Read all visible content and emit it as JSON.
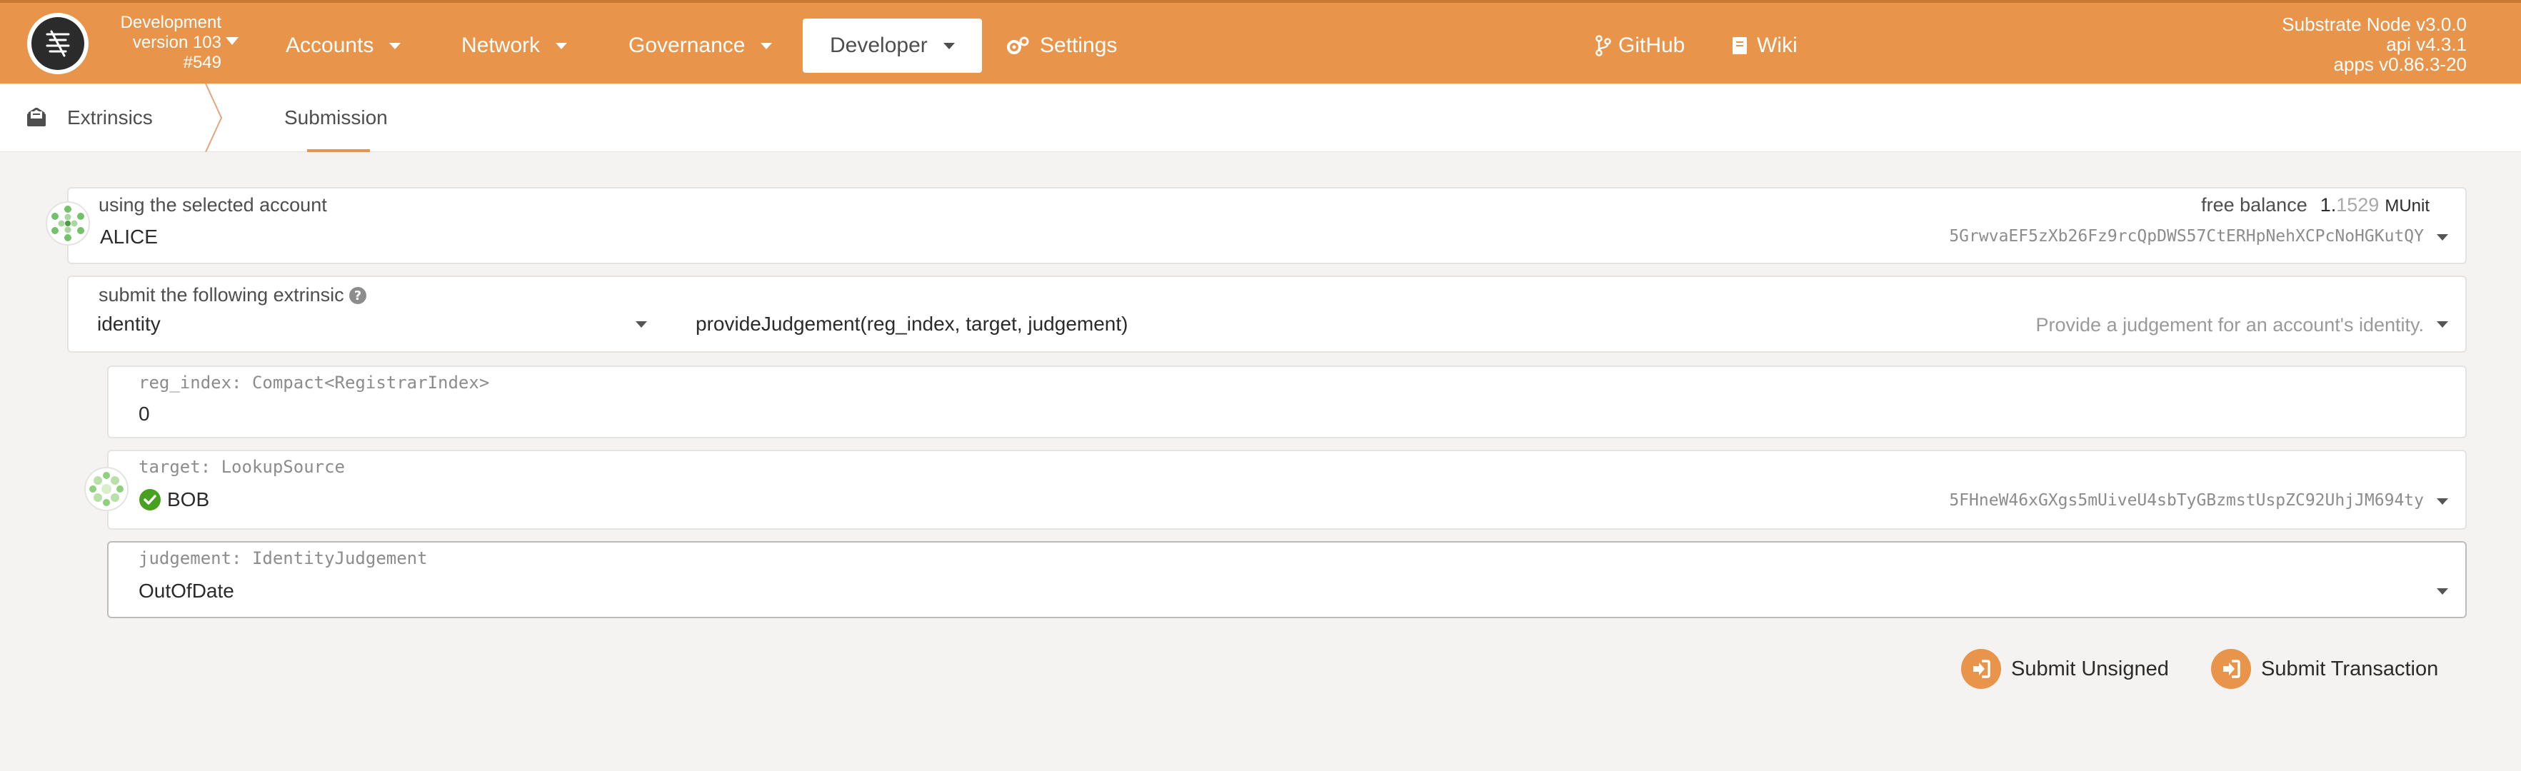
{
  "header": {
    "chain_name": "Development",
    "chain_version": "version 103",
    "block": "#549",
    "nav": [
      {
        "label": "Accounts"
      },
      {
        "label": "Network"
      },
      {
        "label": "Governance"
      },
      {
        "label": "Developer"
      },
      {
        "label": "Settings"
      }
    ],
    "links": [
      {
        "label": "GitHub"
      },
      {
        "label": "Wiki"
      }
    ],
    "node_name": "Substrate Node v3.0.0",
    "api_version": "api v4.3.1",
    "apps_version": "apps v0.86.3-20"
  },
  "tabs": {
    "section": "Extrinsics",
    "active": "Submission"
  },
  "form": {
    "account": {
      "label": "using the selected account",
      "name": "ALICE",
      "free_balance_label": "free balance",
      "balance_main": "1.",
      "balance_fraction": "1529",
      "balance_unit": "MUnit",
      "address": "5GrwvaEF5zXb26Fz9rcQpDWS57CtERHpNehXCPcNoHGKutQY"
    },
    "extrinsic": {
      "label": "submit the following extrinsic",
      "module": "identity",
      "method": "provideJudgement(reg_index, target, judgement)",
      "description": "Provide a judgement for an account's identity."
    },
    "params": {
      "reg_index": {
        "label": "reg_index: Compact<RegistrarIndex>",
        "value": "0"
      },
      "target": {
        "label": "target: LookupSource",
        "name": "BOB",
        "address": "5FHneW46xGXgs5mUiveU4sbTyGBzmstUspZC92UhjJM694ty"
      },
      "judgement": {
        "label": "judgement: IdentityJudgement",
        "value": "OutOfDate"
      }
    }
  },
  "actions": {
    "submit_unsigned": "Submit Unsigned",
    "submit_transaction": "Submit Transaction"
  },
  "colors": {
    "accent": "#e8944a",
    "verified": "#48a020"
  }
}
